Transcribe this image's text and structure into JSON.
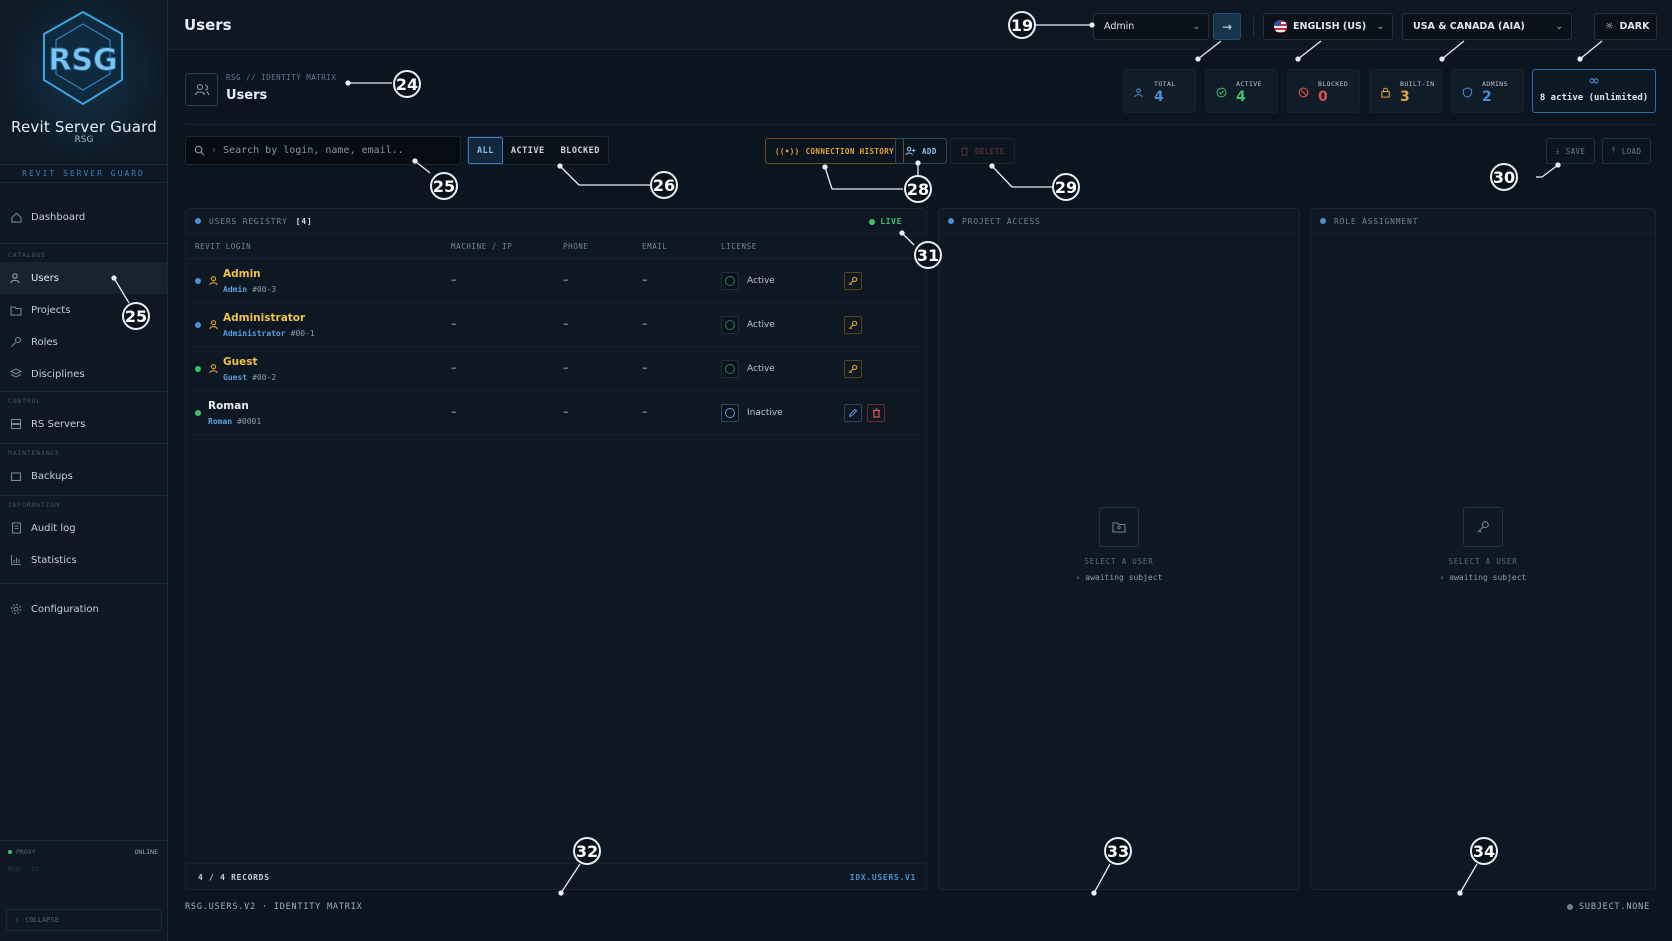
{
  "brand": {
    "name": "Revit Server Guard",
    "abbr": "RSG",
    "tagline": "REVIT SERVER GUARD"
  },
  "sidebar": {
    "sections": {
      "catalogs": "CATALOGS",
      "control": "CONTROL",
      "maintenance": "MAINTENANCE",
      "information": "INFORMATION"
    },
    "items": [
      {
        "label": "Dashboard",
        "icon": "home-icon"
      },
      {
        "label": "Users",
        "icon": "users-icon",
        "active": true
      },
      {
        "label": "Projects",
        "icon": "folder-icon"
      },
      {
        "label": "Roles",
        "icon": "key-icon"
      },
      {
        "label": "Disciplines",
        "icon": "layers-icon"
      },
      {
        "label": "RS Servers",
        "icon": "server-icon"
      },
      {
        "label": "Backups",
        "icon": "archive-icon"
      },
      {
        "label": "Audit log",
        "icon": "log-icon"
      },
      {
        "label": "Statistics",
        "icon": "chart-icon"
      },
      {
        "label": "Configuration",
        "icon": "gear-icon"
      }
    ],
    "footer": {
      "proxy": "PROXY",
      "online": "ONLINE",
      "version": "RSG · V2",
      "collapse": "COLLAPSE"
    }
  },
  "header": {
    "title": "Users",
    "user_select": "Admin",
    "language": "ENGLISH (US)",
    "region": "USA & CANADA (AIA)",
    "theme": "DARK"
  },
  "identity": {
    "breadcrumb": "RSG // IDENTITY MATRIX",
    "title": "Users"
  },
  "stats": [
    {
      "label": "TOTAL",
      "value": "4",
      "color": "#4c8fd6",
      "icon": "users-icon"
    },
    {
      "label": "ACTIVE",
      "value": "4",
      "color": "#3fbf6a",
      "icon": "check-circle-icon"
    },
    {
      "label": "BLOCKED",
      "value": "0",
      "color": "#e05050",
      "icon": "block-icon"
    },
    {
      "label": "BUILT-IN",
      "value": "3",
      "color": "#e2a43b",
      "icon": "lock-icon"
    },
    {
      "label": "ADMINS",
      "value": "2",
      "color": "#4c8fd6",
      "icon": "shield-icon"
    }
  ],
  "license": {
    "icon": "∞",
    "text": "8 active (unlimited)"
  },
  "toolbar": {
    "search_placeholder": "Search by login, name, email..",
    "filters": [
      "ALL",
      "ACTIVE",
      "BLOCKED"
    ],
    "connection_history": "CONNECTION HISTORY",
    "add": "ADD",
    "delete": "DELETE",
    "save": "SAVE",
    "load": "LOAD"
  },
  "registry": {
    "title": "USERS REGISTRY",
    "count": "[4]",
    "live": "LIVE",
    "columns": [
      "REVIT LOGIN",
      "MACHINE / IP",
      "PHONE",
      "EMAIL",
      "LICENSE"
    ],
    "rows": [
      {
        "name": "Admin",
        "login": "Admin",
        "id": "#00-3",
        "machine": "–",
        "phone": "–",
        "email": "–",
        "license": "Active",
        "dot": "#4c8fd6",
        "builtin": true
      },
      {
        "name": "Administrator",
        "login": "Administrator",
        "id": "#00-1",
        "machine": "–",
        "phone": "–",
        "email": "–",
        "license": "Active",
        "dot": "#4c8fd6",
        "builtin": true
      },
      {
        "name": "Guest",
        "login": "Guest",
        "id": "#00-2",
        "machine": "–",
        "phone": "–",
        "email": "–",
        "license": "Active",
        "dot": "#3fbf6a",
        "builtin": true
      },
      {
        "name": "Roman",
        "login": "Roman",
        "id": "#0001",
        "machine": "–",
        "phone": "–",
        "email": "–",
        "license": "Inactive",
        "dot": "#3fbf6a",
        "builtin": false
      }
    ],
    "footer_left": "4 / 4 RECORDS",
    "footer_right": "IDX.USERS.V1"
  },
  "project_access": {
    "title": "PROJECT ACCESS",
    "empty1": "SELECT A USER",
    "empty2": "› awaiting subject"
  },
  "role_assignment": {
    "title": "ROLE ASSIGNMENT",
    "empty1": "SELECT A USER",
    "empty2": "› awaiting subject"
  },
  "statusbar": {
    "left": "RSG.USERS.V2 · IDENTITY MATRIX",
    "right": "SUBJECT.NONE"
  },
  "annotations": [
    "19",
    "24",
    "25",
    "26",
    "28",
    "29",
    "30",
    "25",
    "31",
    "32",
    "33",
    "34"
  ]
}
